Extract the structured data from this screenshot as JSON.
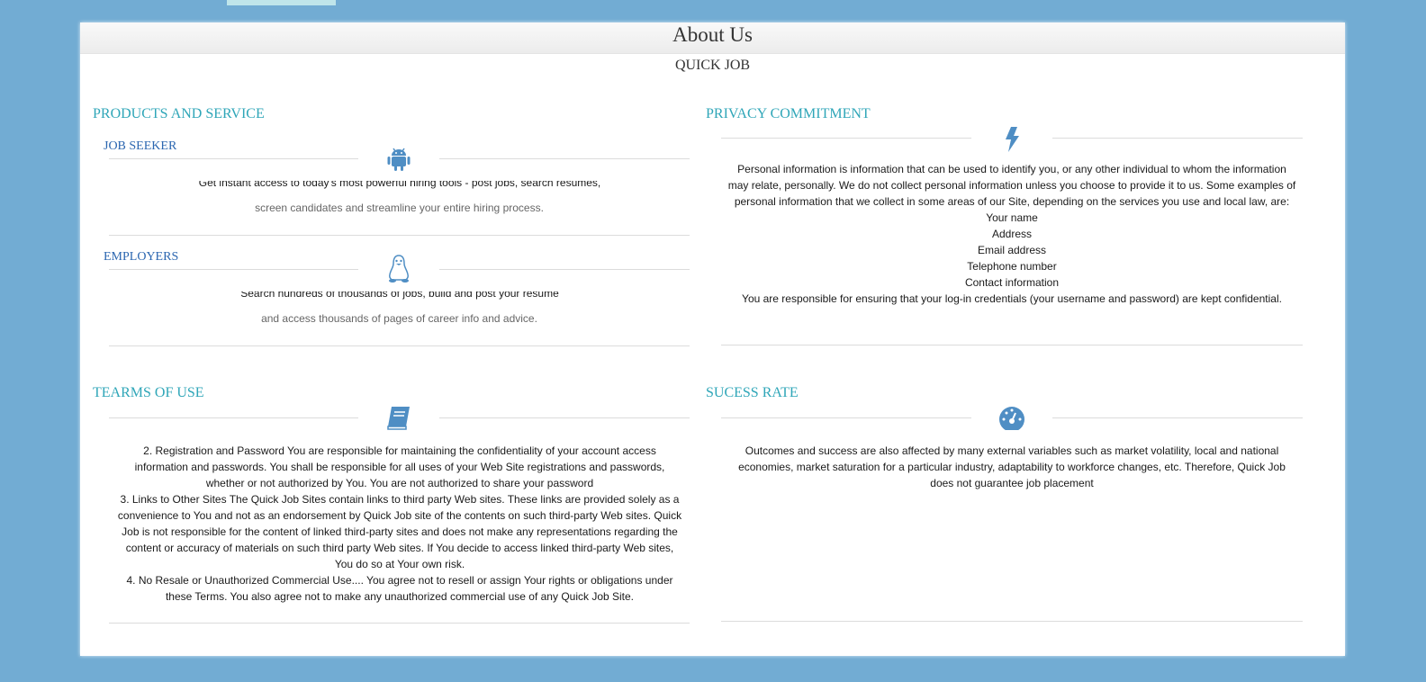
{
  "header": {
    "title": "About Us",
    "subtitle": "QUICK JOB"
  },
  "products": {
    "title": "PRODUCTS AND SERVICE",
    "job_seeker": {
      "title": "JOB SEEKER",
      "icon": "android-icon",
      "line1": "Get instant access to today's most powerful hiring tools - post jobs, search resumes,",
      "line2": "screen candidates and streamline your entire hiring process."
    },
    "employers": {
      "title": "EMPLOYERS",
      "icon": "linux-icon",
      "line1": "Search hundreds of thousands of jobs, build and post your resume",
      "line2": "and access thousands of pages of career info and advice."
    }
  },
  "privacy": {
    "title": "PRIVACY COMMITMENT",
    "icon": "bolt-icon",
    "paragraph": "Personal information is information that can be used to identify you, or any other individual to whom the information may relate, personally. We do not collect personal information unless you choose to provide it to us. Some examples of personal information that we collect in some areas of our Site, depending on the services you use and local law, are: Your name",
    "items": [
      "Address",
      "Email address",
      "Telephone number",
      "Contact information"
    ],
    "closing": "You are responsible for ensuring that your log-in credentials (your username and password) are kept confidential."
  },
  "terms": {
    "title": "TEARMS OF USE",
    "icon": "book-icon",
    "p2": "2. Registration and Password You are responsible for maintaining the confidentiality of your account access information and passwords. You shall be responsible for all uses of your Web Site registrations and passwords, whether or not authorized by You. You are not authorized to share your password",
    "p3": "3. Links to Other Sites The Quick Job Sites contain links to third party Web sites. These links are provided solely as a convenience to You and not as an endorsement by Quick Job site of the contents on such third-party Web sites. Quick Job is not responsible for the content of linked third-party sites and does not make any representations regarding the content or accuracy of materials on such third party Web sites. If You decide to access linked third-party Web sites, You do so at Your own risk.",
    "p4": "4. No Resale or Unauthorized Commercial Use.... You agree not to resell or assign Your rights or obligations under these Terms. You also agree not to make any unauthorized commercial use of any Quick Job Site."
  },
  "success": {
    "title": "SUCESS RATE",
    "icon": "dashboard-icon",
    "paragraph": "Outcomes and success are also affected by many external variables such as market volatility, local and national economies, market saturation for a particular industry, adaptability to workforce changes, etc. Therefore, Quick Job does not guarantee job placement"
  }
}
